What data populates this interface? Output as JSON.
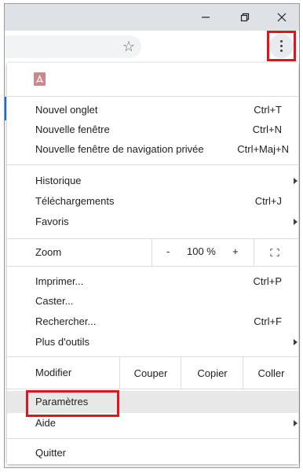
{
  "window": {
    "minimize_icon": "minimize-icon",
    "maximize_icon": "restore-icon",
    "close_icon": "close-icon"
  },
  "toolbar": {
    "star_icon": "star-icon",
    "menu_icon": "kebab-menu-icon"
  },
  "menu": {
    "app_icon": "pdf-icon",
    "group1": [
      {
        "label": "Nouvel onglet",
        "shortcut": "Ctrl+T"
      },
      {
        "label": "Nouvelle fenêtre",
        "shortcut": "Ctrl+N"
      },
      {
        "label": "Nouvelle fenêtre de navigation privée",
        "shortcut": "Ctrl+Maj+N"
      }
    ],
    "group2": [
      {
        "label": "Historique",
        "shortcut": ""
      },
      {
        "label": "Téléchargements",
        "shortcut": "Ctrl+J"
      },
      {
        "label": "Favoris",
        "shortcut": ""
      }
    ],
    "zoom": {
      "label": "Zoom",
      "minus": "-",
      "value": "100 %",
      "plus": "+"
    },
    "group3": [
      {
        "label": "Imprimer...",
        "shortcut": "Ctrl+P"
      },
      {
        "label": "Caster...",
        "shortcut": ""
      },
      {
        "label": "Rechercher...",
        "shortcut": "Ctrl+F"
      },
      {
        "label": "Plus d'outils",
        "shortcut": ""
      }
    ],
    "edit": {
      "label": "Modifier",
      "cut": "Couper",
      "copy": "Copier",
      "paste": "Coller"
    },
    "group4": [
      {
        "label": "Paramètres"
      },
      {
        "label": "Aide"
      }
    ],
    "quit": "Quitter"
  },
  "colors": {
    "highlight": "#e0141e",
    "titlebar": "#dee1e6"
  }
}
